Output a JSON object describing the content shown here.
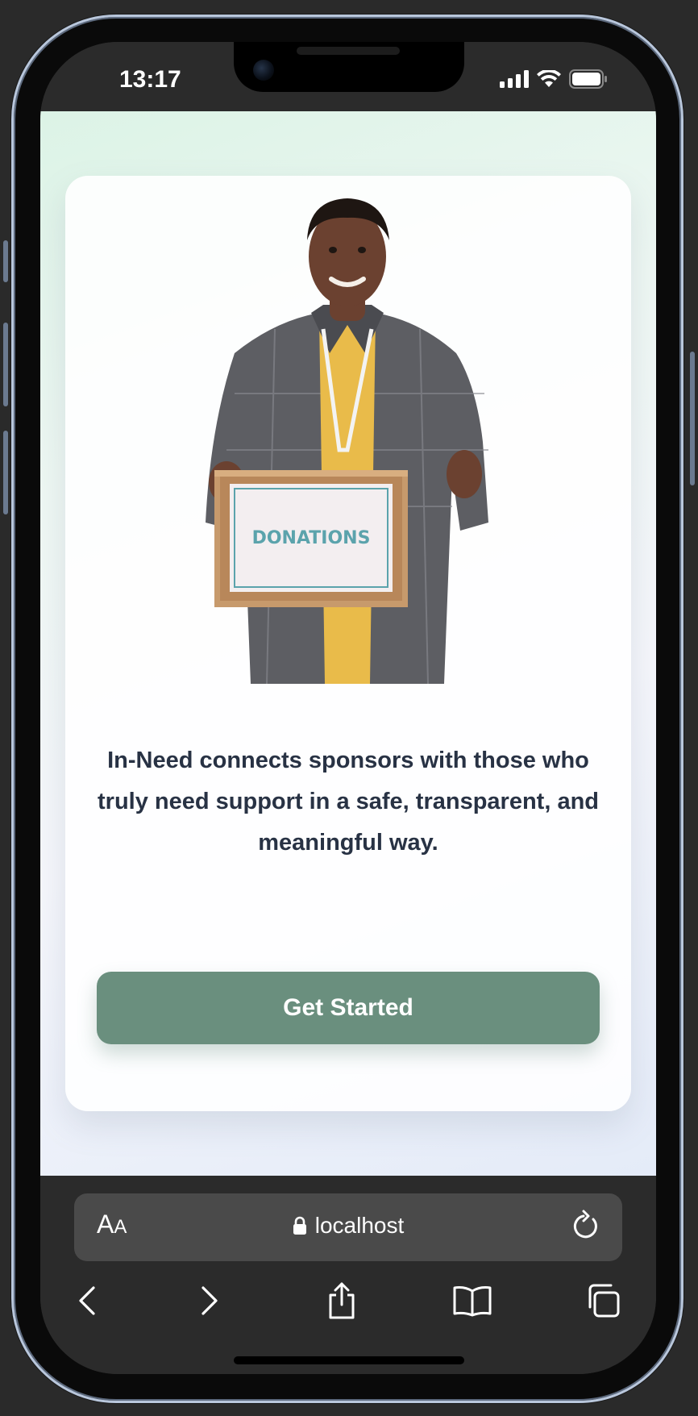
{
  "status_bar": {
    "time": "13:17",
    "icons": [
      "cellular-signal-icon",
      "wifi-icon",
      "battery-icon"
    ]
  },
  "page": {
    "hero_image": {
      "description_icon": "volunteer-with-donation-box",
      "box_label": "DONATIONS"
    },
    "tagline": "In-Need connects sponsors with those who truly need support in a safe, transparent, and meaningful way.",
    "cta_label": "Get Started"
  },
  "browser": {
    "text_size_big": "A",
    "text_size_small": "A",
    "url": "localhost",
    "toolbar": [
      "back-icon",
      "forward-icon",
      "share-icon",
      "bookmarks-icon",
      "tabs-icon"
    ]
  },
  "colors": {
    "cta": "#6a8f7e",
    "text": "#283244",
    "box_label": "#5ba3ac"
  }
}
